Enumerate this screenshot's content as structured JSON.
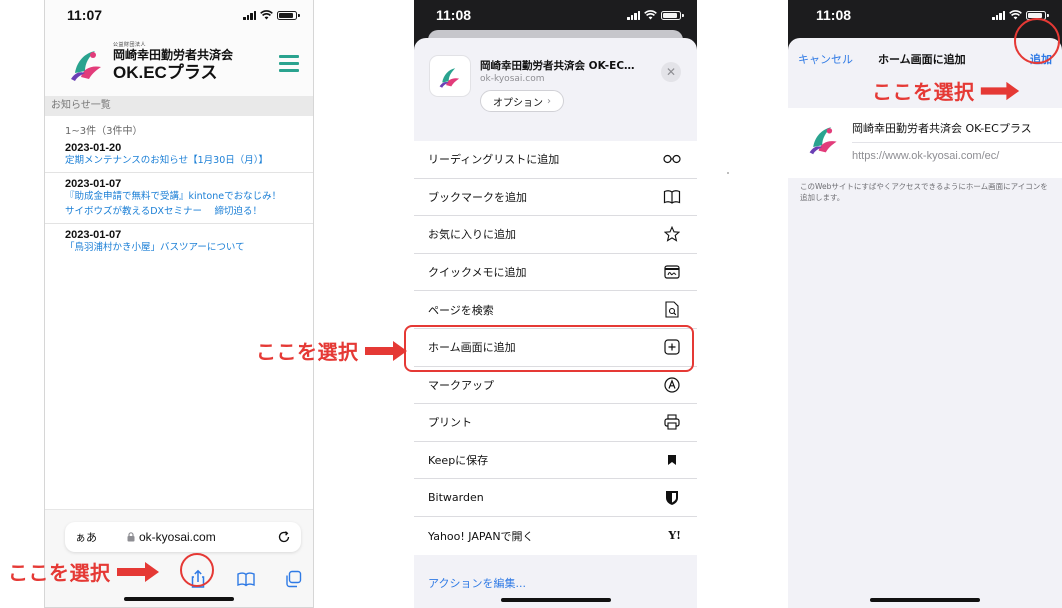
{
  "callouts": {
    "select_here": "ここを選択"
  },
  "phone1": {
    "time": "11:07",
    "org_small": "公益財団法人",
    "org_name": "岡崎幸田勤労者共済会",
    "brand": "OK.ECプラス",
    "section_title": "お知らせ一覧",
    "count": "1~3件（3件中）",
    "notices": [
      {
        "date": "2023-01-20",
        "lines": [
          "定期メンテナンスのお知らせ【1月30日（月）】"
        ]
      },
      {
        "date": "2023-01-07",
        "lines": [
          "『助成金申請で無料で受講』kintoneでおなじみ！",
          "サイボウズが教えるDXセミナー　 締切迫る！"
        ]
      },
      {
        "date": "2023-01-07",
        "lines": [
          "「鳥羽浦村かき小屋」バスツアーについて"
        ]
      }
    ],
    "url_bar": {
      "aa": "ぁあ",
      "url": "ok-kyosai.com"
    },
    "colors": {
      "accent": "#2aa38f",
      "link": "#1b7fd6"
    }
  },
  "phone2": {
    "time": "11:08",
    "site_title": "岡崎幸田勤労者共済会 OK-EC…",
    "site_url": "ok-kyosai.com",
    "options_label": "オプション",
    "menu_items": [
      {
        "label": "リーディングリストに追加",
        "icon": "glasses-icon"
      },
      {
        "label": "ブックマークを追加",
        "icon": "book-icon"
      },
      {
        "label": "お気に入りに追加",
        "icon": "star-icon"
      },
      {
        "label": "クイックメモに追加",
        "icon": "quick-note-icon"
      },
      {
        "label": "ページを検索",
        "icon": "find-page-icon"
      },
      {
        "label": "ホーム画面に追加",
        "icon": "add-square-icon"
      },
      {
        "label": "マークアップ",
        "icon": "markup-icon"
      },
      {
        "label": "プリント",
        "icon": "printer-icon"
      },
      {
        "label": "Keepに保存",
        "icon": "bookmark-flag-icon"
      },
      {
        "label": "Bitwarden",
        "icon": "shield-icon"
      },
      {
        "label": "Yahoo! JAPANで開く",
        "icon": "yahoo-icon"
      }
    ],
    "yahoo_glyph": "Y!",
    "edit_actions": "アクションを編集..."
  },
  "phone3": {
    "time": "11:08",
    "cancel": "キャンセル",
    "title": "ホーム画面に追加",
    "add": "追加",
    "app_name": "岡崎幸田勤労者共済会 OK-ECプラス",
    "url": "https://www.ok-kyosai.com/ec/",
    "description": "このWebサイトにすばやくアクセスできるようにホーム画面にアイコンを追加します。"
  }
}
